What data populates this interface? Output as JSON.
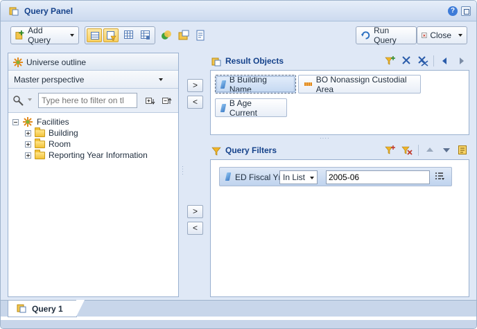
{
  "window": {
    "title": "Query Panel",
    "help_label": "?"
  },
  "toolbar": {
    "add_query_label": "Add Query",
    "run_query_label": "Run Query",
    "close_label": "Close"
  },
  "universe": {
    "header_label": "Universe outline",
    "perspective": "Master perspective",
    "filter_placeholder": "Type here to filter on tl",
    "tree": [
      {
        "label": "Facilities",
        "level": 0
      },
      {
        "label": "Building",
        "level": 1
      },
      {
        "label": "Room",
        "level": 1
      },
      {
        "label": "Reporting Year Information",
        "level": 1
      }
    ]
  },
  "move_buttons": {
    "right": ">",
    "left": "<"
  },
  "result_objects": {
    "title": "Result Objects",
    "items": [
      {
        "label": "B Building Name",
        "kind": "dimension",
        "selected": true
      },
      {
        "label": "BO Nonassign Custodial Area",
        "kind": "measure",
        "selected": false
      },
      {
        "label": "B Age Current",
        "kind": "dimension",
        "selected": false
      }
    ]
  },
  "query_filters": {
    "title": "Query Filters",
    "filter": {
      "object": "ED Fiscal Yr",
      "operator": "In List",
      "value": "2005-06"
    }
  },
  "tabs": {
    "query_tab": "Query 1"
  },
  "colors": {
    "accent_title": "#15428b",
    "selection_fill": "#c3d7f1",
    "panel_border": "#99b0cf"
  }
}
